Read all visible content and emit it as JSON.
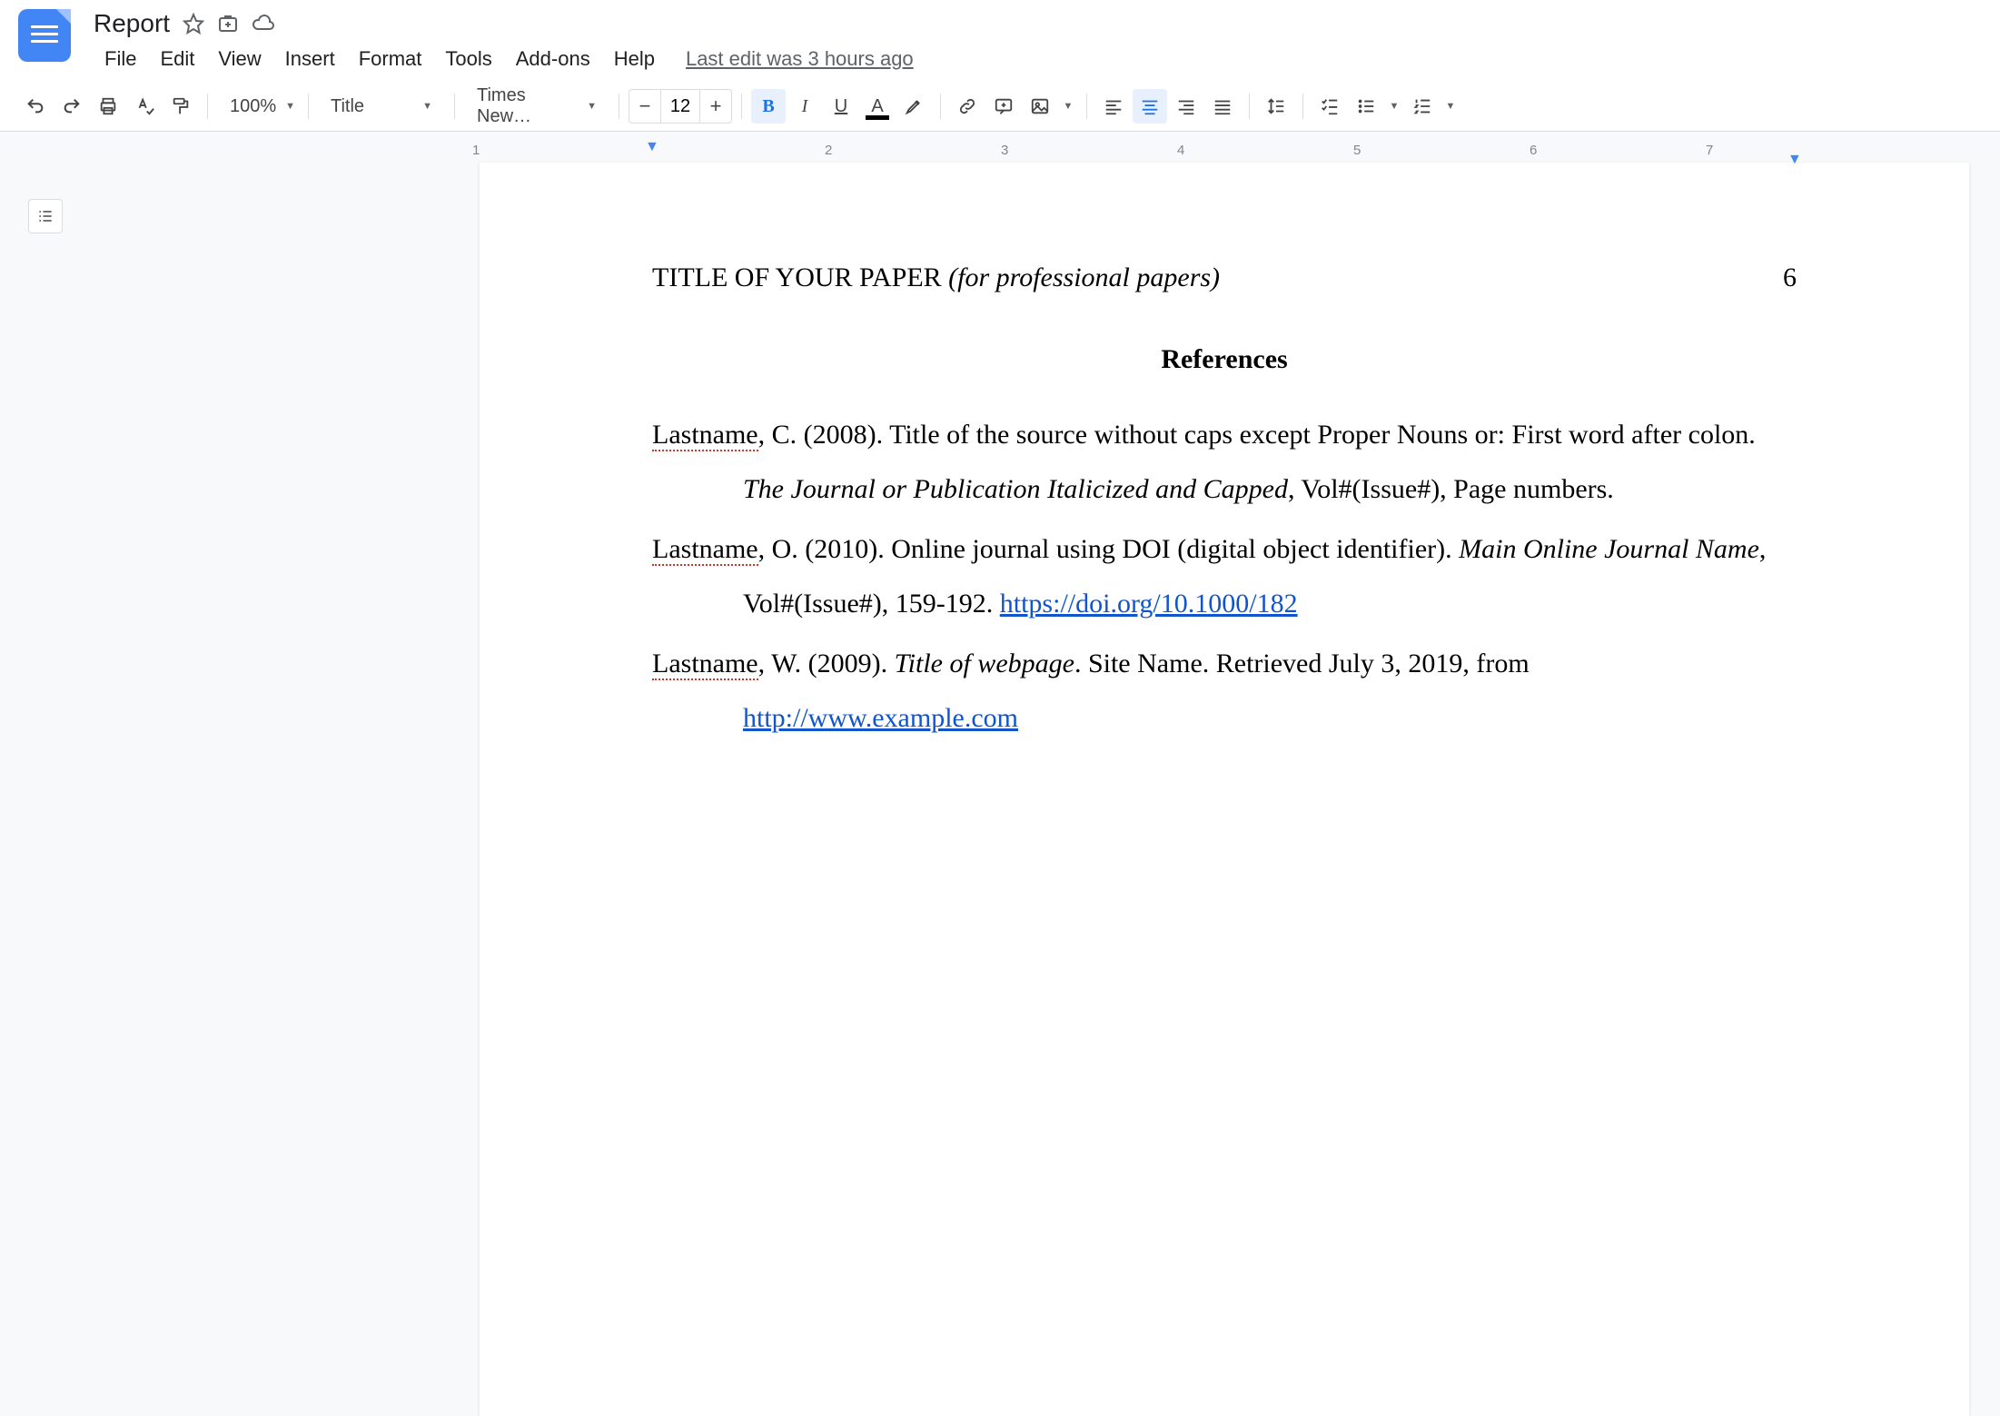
{
  "doc": {
    "title": "Report"
  },
  "menu": {
    "file": "File",
    "edit": "Edit",
    "view": "View",
    "insert": "Insert",
    "format": "Format",
    "tools": "Tools",
    "addons": "Add-ons",
    "help": "Help",
    "last_edit": "Last edit was 3 hours ago"
  },
  "toolbar": {
    "zoom": "100%",
    "style": "Title",
    "font": "Times New…",
    "fontsize": "12"
  },
  "ruler": {
    "marks": [
      "1",
      "2",
      "3",
      "4",
      "5",
      "6",
      "7"
    ]
  },
  "page": {
    "running_head": "TITLE OF YOUR PAPER",
    "running_head_ital": "(for professional papers)",
    "page_number": "6",
    "heading": "References",
    "refs": [
      {
        "p1a": "Lastname",
        "p1b": ", C. (2008). Title of the source without caps except Proper Nouns or: First word after colon. ",
        "ital": "The Journal or Publication Italicized and Capped",
        "p2": ", Vol#(Issue#), Page numbers."
      },
      {
        "p1a": "Lastname",
        "p1b": ", O. (2010). Online journal using DOI (digital object identifier). ",
        "ital": "Main Online Journal Name",
        "p2": ", Vol#(Issue#), 159-192. ",
        "link": "https://doi.org/10.1000/182"
      },
      {
        "p1a": "Lastname",
        "p1b": ", W. (2009). ",
        "ital": "Title of webpage",
        "p2": ". Site Name. Retrieved July 3, 2019, from ",
        "link": "http://www.example.com"
      }
    ]
  }
}
